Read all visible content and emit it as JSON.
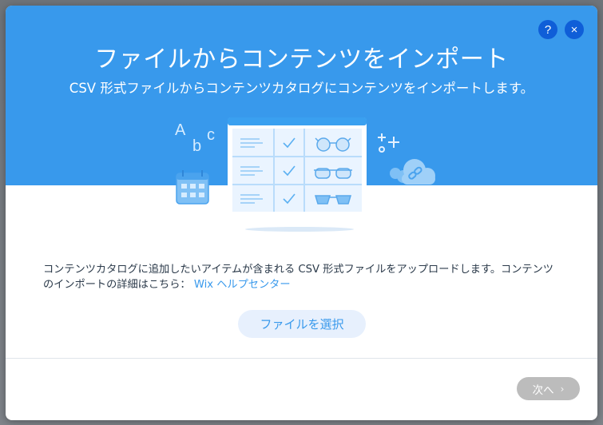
{
  "dialog": {
    "title": "ファイルからコンテンツをインポート",
    "subtitle": "CSV 形式ファイルからコンテンツカタログにコンテンツをインポートします。",
    "help_icon": "?",
    "close_icon": "×"
  },
  "illustration": {
    "letters": [
      "A",
      "b",
      "c"
    ],
    "icons": [
      "calendar-icon",
      "table-icon",
      "glasses-icon",
      "cloud-link-icon",
      "plus-icon"
    ]
  },
  "body": {
    "text": "コンテンツカタログに追加したいアイテムが含まれる CSV 形式ファイルをアップロードします。コンテンツのインポートの詳細はこちら：",
    "link_label": "Wix ヘルプセンター"
  },
  "actions": {
    "choose_file_label": "ファイルを選択",
    "next_label": "次へ",
    "next_arrow": "›"
  },
  "colors": {
    "header_bg": "#3899ec",
    "accent": "#3899ec",
    "header_button": "#0f5ed8",
    "disabled_button": "#bcbcbc"
  }
}
